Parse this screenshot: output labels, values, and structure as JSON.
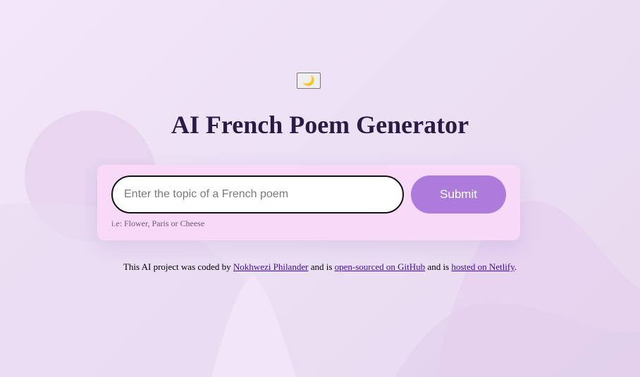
{
  "theme_toggle": {
    "glyph": "🌙",
    "icon": "moon-icon"
  },
  "title": "AI French Poem Generator",
  "form": {
    "input_placeholder": "Enter the topic of a French poem",
    "input_value": "",
    "submit_label": "Submit",
    "hint": "i.e: Flower, Paris or Cheese"
  },
  "footer": {
    "prefix": "This AI project was coded by ",
    "author_link": "Nokhwezi Philander",
    "middle1": " and is ",
    "github_link": "open-sourced on GitHub",
    "middle2": " and is ",
    "netlify_link": "hosted on Netlify",
    "suffix": "."
  },
  "colors": {
    "background": "#efe3f5",
    "card": "#f8d9f8",
    "button": "#ad7bdb",
    "title": "#2a1b43",
    "link": "#3d0aa8"
  }
}
